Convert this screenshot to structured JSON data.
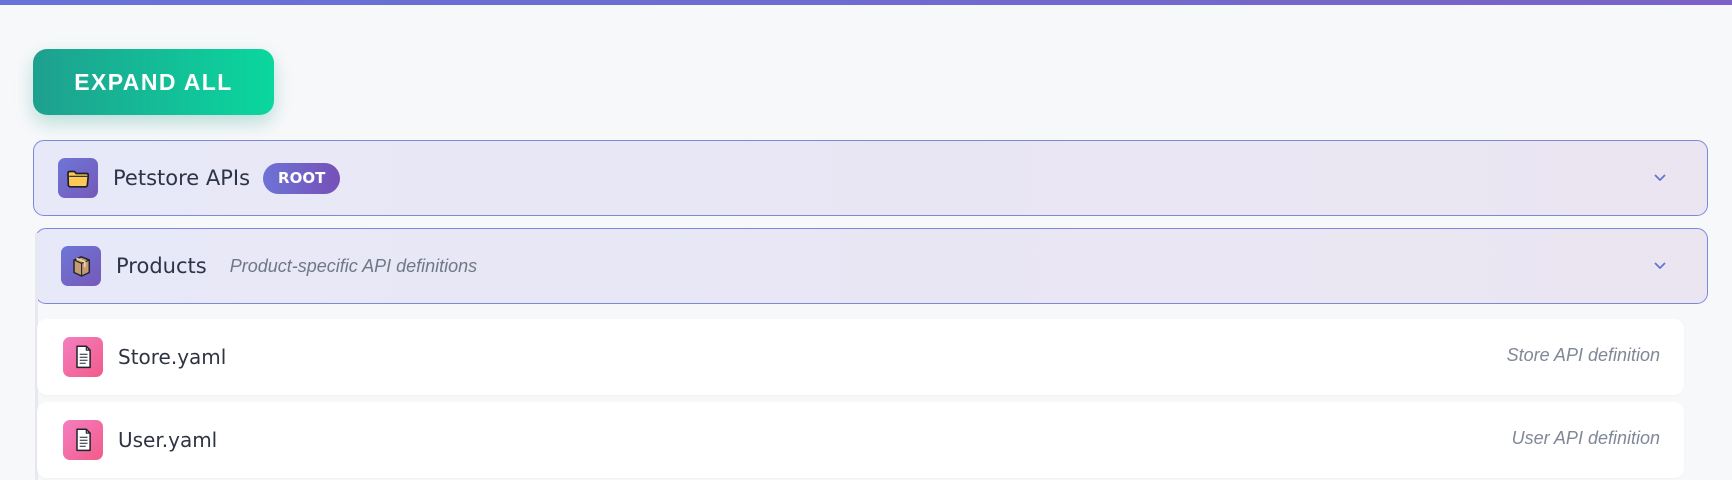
{
  "toolbar": {
    "expand_all_label": "EXPAND ALL"
  },
  "tree": {
    "root": {
      "label": "Petstore APIs",
      "badge": "ROOT",
      "icon": "folder-icon",
      "chevron": "chevron-down-icon"
    },
    "products": {
      "label": "Products",
      "description": "Product-specific API definitions",
      "icon": "package-icon",
      "chevron": "chevron-down-icon"
    },
    "files": [
      {
        "name": "Store.yaml",
        "description": "Store API definition",
        "icon": "document-icon"
      },
      {
        "name": "User.yaml",
        "description": "User API definition",
        "icon": "document-icon"
      }
    ]
  },
  "colors": {
    "accent": "#6673d8",
    "button_start": "#1ea08f",
    "button_end": "#0ad79e",
    "folder_border": "#7e88db",
    "file_icon": "#f25b88"
  }
}
